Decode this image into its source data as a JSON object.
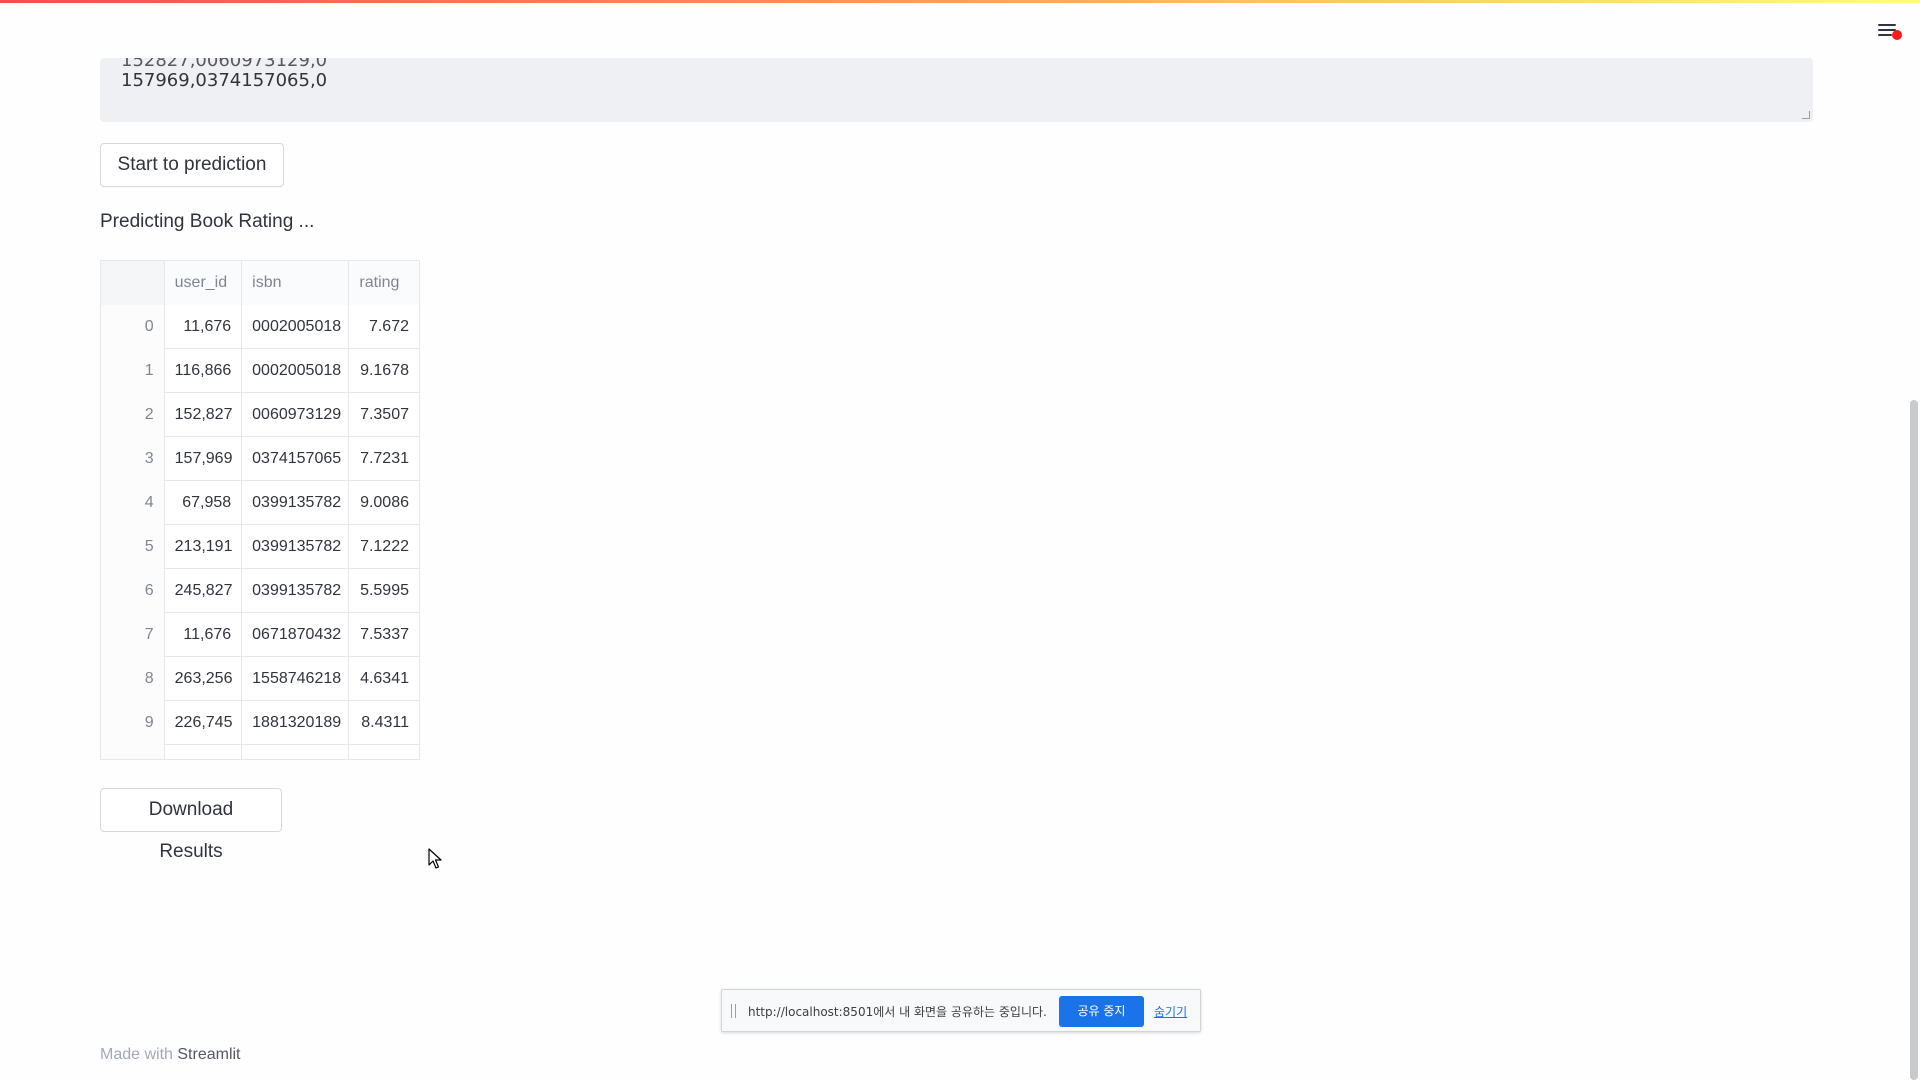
{
  "textarea": {
    "lines": [
      "152827,0060973129,0",
      "157969,0374157065,0"
    ]
  },
  "buttons": {
    "predict_label": "Start to prediction",
    "download_label": "Download Results"
  },
  "status": {
    "text": "Predicting Book Rating ..."
  },
  "table": {
    "columns": [
      "",
      "user_id",
      "isbn",
      "rating"
    ],
    "rows": [
      {
        "idx": "0",
        "user_id": "11,676",
        "isbn": "0002005018",
        "rating": "7.672"
      },
      {
        "idx": "1",
        "user_id": "116,866",
        "isbn": "0002005018",
        "rating": "9.1678"
      },
      {
        "idx": "2",
        "user_id": "152,827",
        "isbn": "0060973129",
        "rating": "7.3507"
      },
      {
        "idx": "3",
        "user_id": "157,969",
        "isbn": "0374157065",
        "rating": "7.7231"
      },
      {
        "idx": "4",
        "user_id": "67,958",
        "isbn": "0399135782",
        "rating": "9.0086"
      },
      {
        "idx": "5",
        "user_id": "213,191",
        "isbn": "0399135782",
        "rating": "7.1222"
      },
      {
        "idx": "6",
        "user_id": "245,827",
        "isbn": "0399135782",
        "rating": "5.5995"
      },
      {
        "idx": "7",
        "user_id": "11,676",
        "isbn": "0671870432",
        "rating": "7.5337"
      },
      {
        "idx": "8",
        "user_id": "263,256",
        "isbn": "1558746218",
        "rating": "4.6341"
      },
      {
        "idx": "9",
        "user_id": "226,745",
        "isbn": "1881320189",
        "rating": "8.4311"
      }
    ]
  },
  "footer": {
    "prefix": "Made with",
    "brand": "Streamlit"
  },
  "share_bar": {
    "text": "http://localhost:8501에서 내 화면을 공유하는 중입니다.",
    "stop_label": "공유 중지",
    "hide_label": "숨기기"
  },
  "colors": {
    "accent_red": "#ff4b4b",
    "share_blue": "#1a73e8",
    "notification_dot": "#ff1a1a"
  },
  "icons": {
    "menu": "hamburger-menu-icon",
    "cursor": "mouse-pointer-icon"
  }
}
